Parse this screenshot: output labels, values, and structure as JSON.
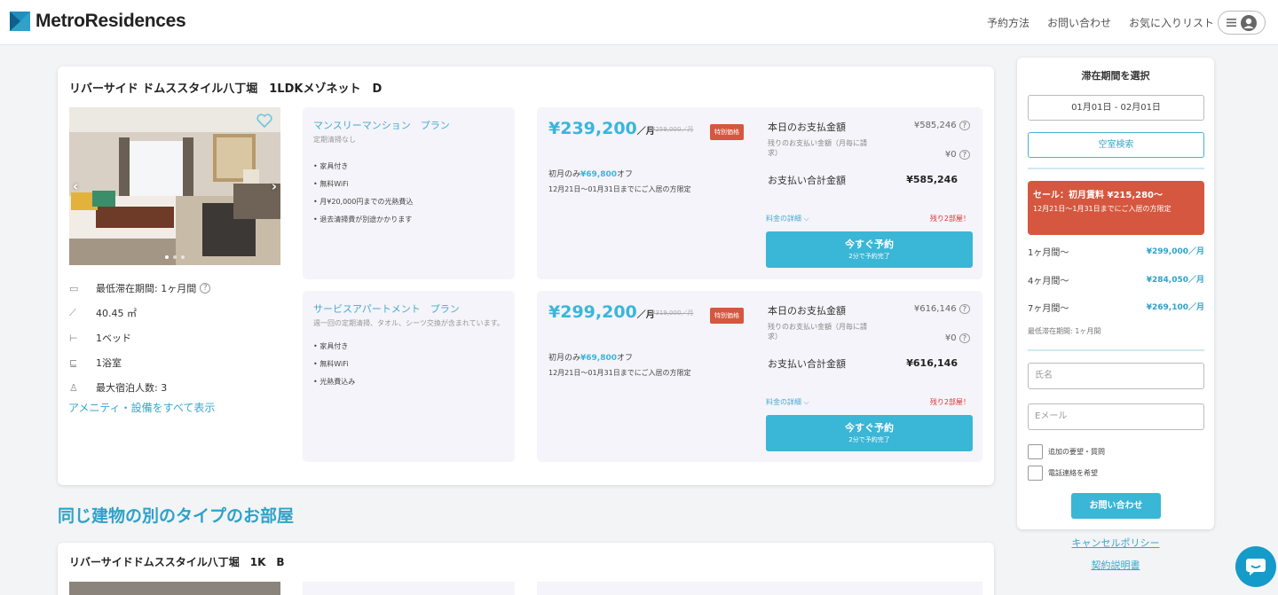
{
  "brand": {
    "name": "MetroResidences",
    "color": "#2ea2c9"
  },
  "nav": {
    "booking": "予約方法",
    "contact": "お問い合わせ",
    "favorites": "お気に入りリスト"
  },
  "listing": {
    "title": "リバーサイド ドムススタイル八丁堀　1LDKメゾネット　D",
    "specs": [
      {
        "icon": "calendar-icon",
        "text": "最低滞在期間: 1ヶ月間"
      },
      {
        "icon": "ruler-icon",
        "text": "40.45 ㎡"
      },
      {
        "icon": "bed-icon",
        "text": "1ベッド"
      },
      {
        "icon": "bath-icon",
        "text": "1浴室"
      },
      {
        "icon": "person-icon",
        "text": "最大宿泊人数: 3"
      }
    ],
    "amenities_link": "アメニティ・設備をすべて表示"
  },
  "plans": [
    {
      "title": "マンスリーマンション　プラン",
      "subtitle": "定期清掃なし",
      "features": [
        "家具付き",
        "無料WiFi",
        "月¥20,000円までの光熱費込",
        "退去清掃費が別途かかります"
      ],
      "price": "¥239,200",
      "per": "／月",
      "strike": "¥259,000／月",
      "badge": "特別価格",
      "discount_prefix": "初月のみ",
      "discount_amount": "¥69,800",
      "discount_suffix": "オフ",
      "condition": "12月21日～01月31日までにご入居の方限定",
      "pay_today_label": "本日のお支払金額",
      "pay_today_value": "¥585,246",
      "remaining_label": "残りのお支払い金額（月毎に請求）",
      "remaining_value": "¥0",
      "total_label": "お支払い合計金額",
      "total_value": "¥585,246",
      "detail_link": "料金の詳細",
      "remaining_rooms": "残り2部屋！",
      "book_label": "今すぐ予約",
      "book_sub": "2分で予約完了"
    },
    {
      "title": "サービスアパートメント　プラン",
      "subtitle": "週一回の定期清掃、タオル、シーツ交換が含まれています。",
      "features": [
        "家具付き",
        "無料WiFi",
        "光熱費込み"
      ],
      "price": "¥299,200",
      "per": "／月",
      "strike": "¥319,000／月",
      "badge": "特別価格",
      "discount_prefix": "初月のみ",
      "discount_amount": "¥69,800",
      "discount_suffix": "オフ",
      "condition": "12月21日～01月31日までにご入居の方限定",
      "pay_today_label": "本日のお支払金額",
      "pay_today_value": "¥616,146",
      "remaining_label": "残りのお支払い金額（月毎に請求）",
      "remaining_value": "¥0",
      "total_label": "お支払い合計金額",
      "total_value": "¥616,146",
      "detail_link": "料金の詳細",
      "remaining_rooms": "残り2部屋！",
      "book_label": "今すぐ予約",
      "book_sub": "2分で予約完了"
    }
  ],
  "section_title": "同じ建物の別のタイプのお部屋",
  "second_listing": {
    "title": "リバーサイドドムススタイル八丁堀　1K　B"
  },
  "sidebar": {
    "title": "滞在期間を選択",
    "date_value": "01月01日 - 02月01日",
    "vacancy_button": "空室検索",
    "sale_title": "セール：初月賃料 ¥215,280～",
    "sale_sub": "12月21日～1月31日までにご入居の方限定",
    "rates": [
      {
        "label": "1ヶ月間～",
        "price": "¥299,000／月"
      },
      {
        "label": "4ヶ月間～",
        "price": "¥284,050／月"
      },
      {
        "label": "7ヶ月間～",
        "price": "¥269,100／月"
      }
    ],
    "min_stay": "最低滞在期間: 1ヶ月間",
    "name_placeholder": "氏名",
    "email_placeholder": "Eメール",
    "check1": "追加の要望・質問",
    "check2": "電話連絡を希望",
    "contact_button": "お問い合わせ"
  },
  "links": {
    "cancel_policy": "キャンセルポリシー",
    "contract": "契約説明書"
  },
  "colors": {
    "accent": "#3ab6d6",
    "sale": "#d5573f",
    "link": "#3aa6c9"
  }
}
